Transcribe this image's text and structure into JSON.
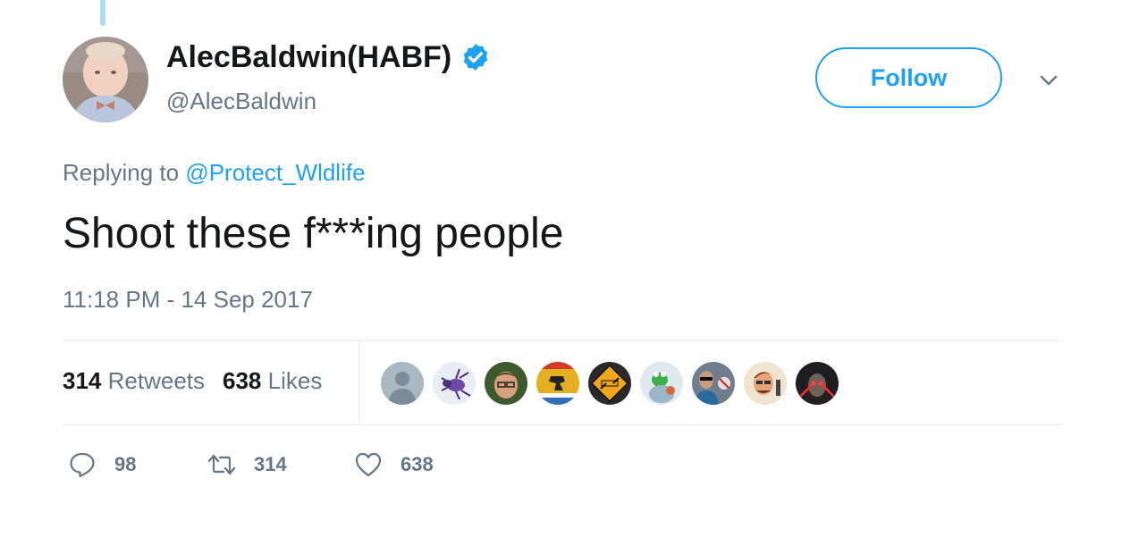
{
  "tweet": {
    "author": {
      "display_name": "AlecBaldwin(HABF)",
      "handle": "@AlecBaldwin",
      "verified": true
    },
    "follow_label": "Follow",
    "reply_prefix": "Replying to",
    "reply_to": "@Protect_Wldlife",
    "text": "Shoot these f***ing people",
    "timestamp": "11:18 PM - 14 Sep 2017",
    "stats": {
      "retweets_count": "314",
      "retweets_label": "Retweets",
      "likes_count": "638",
      "likes_label": "Likes"
    },
    "liker_avatars": [
      "default-avatar",
      "spider-avatar",
      "man-avatar",
      "flag-avatar",
      "road-sign-avatar",
      "frog-avatar",
      "man-sunglasses-avatar",
      "cartoon-man-avatar",
      "laser-eyes-avatar"
    ],
    "actions": {
      "reply_count": "98",
      "retweet_count": "314",
      "like_count": "638"
    }
  },
  "colors": {
    "accent": "#1da1f2",
    "secondary_text": "#657786",
    "primary_text": "#14171a",
    "divider": "#e6ecf0",
    "thread_line": "#a9dcf8"
  }
}
